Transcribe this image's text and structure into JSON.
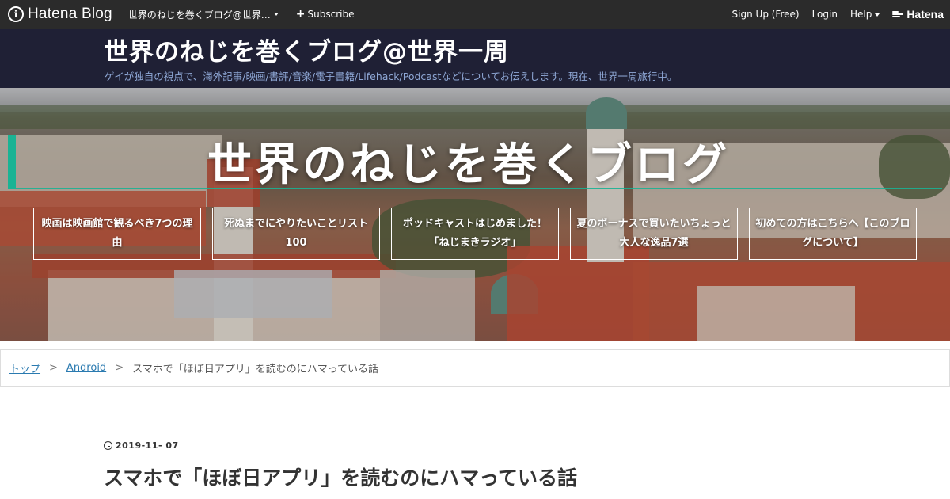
{
  "topbar": {
    "logo_text": "Hatena Blog",
    "blog_name": "世界のねじを巻くブログ@世界…",
    "subscribe_label": "Subscribe",
    "signup_label": "Sign Up (Free)",
    "login_label": "Login",
    "help_label": "Help",
    "hatena_label": "Hatena"
  },
  "header": {
    "title": "世界のねじを巻くブログ@世界一周",
    "description": "ゲイが独自の視点で、海外記事/映画/書評/音楽/電子書籍/Lifehack/Podcastなどについてお伝えします。現在、世界一周旅行中。"
  },
  "hero": {
    "title": "世界のねじを巻くブログ",
    "features": [
      {
        "label": "映画は映画館で観るべき7つの理由"
      },
      {
        "label": "死ぬまでにやりたいことリスト100"
      },
      {
        "label": "ポッドキャストはじめました！「ねじまきラジオ」"
      },
      {
        "label": "夏のボーナスで買いたいちょっと大人な逸品7選"
      },
      {
        "label": "初めての方はこちらへ【このブログについて】"
      }
    ]
  },
  "breadcrumb": {
    "items": [
      {
        "label": "トップ"
      },
      {
        "label": "Android"
      }
    ],
    "separator": ">",
    "current": "スマホで「ほぼ日アプリ」を読むのにハマっている話"
  },
  "article": {
    "date": "2019-11- 07",
    "title": "スマホで「ほぼ日アプリ」を読むのにハマっている話"
  },
  "colors": {
    "topbar_bg": "#2b2b2b",
    "header_bg": "#1f2035",
    "accent": "#1ab394",
    "link": "#2a7ab0",
    "description_text": "#8fa8d6"
  }
}
